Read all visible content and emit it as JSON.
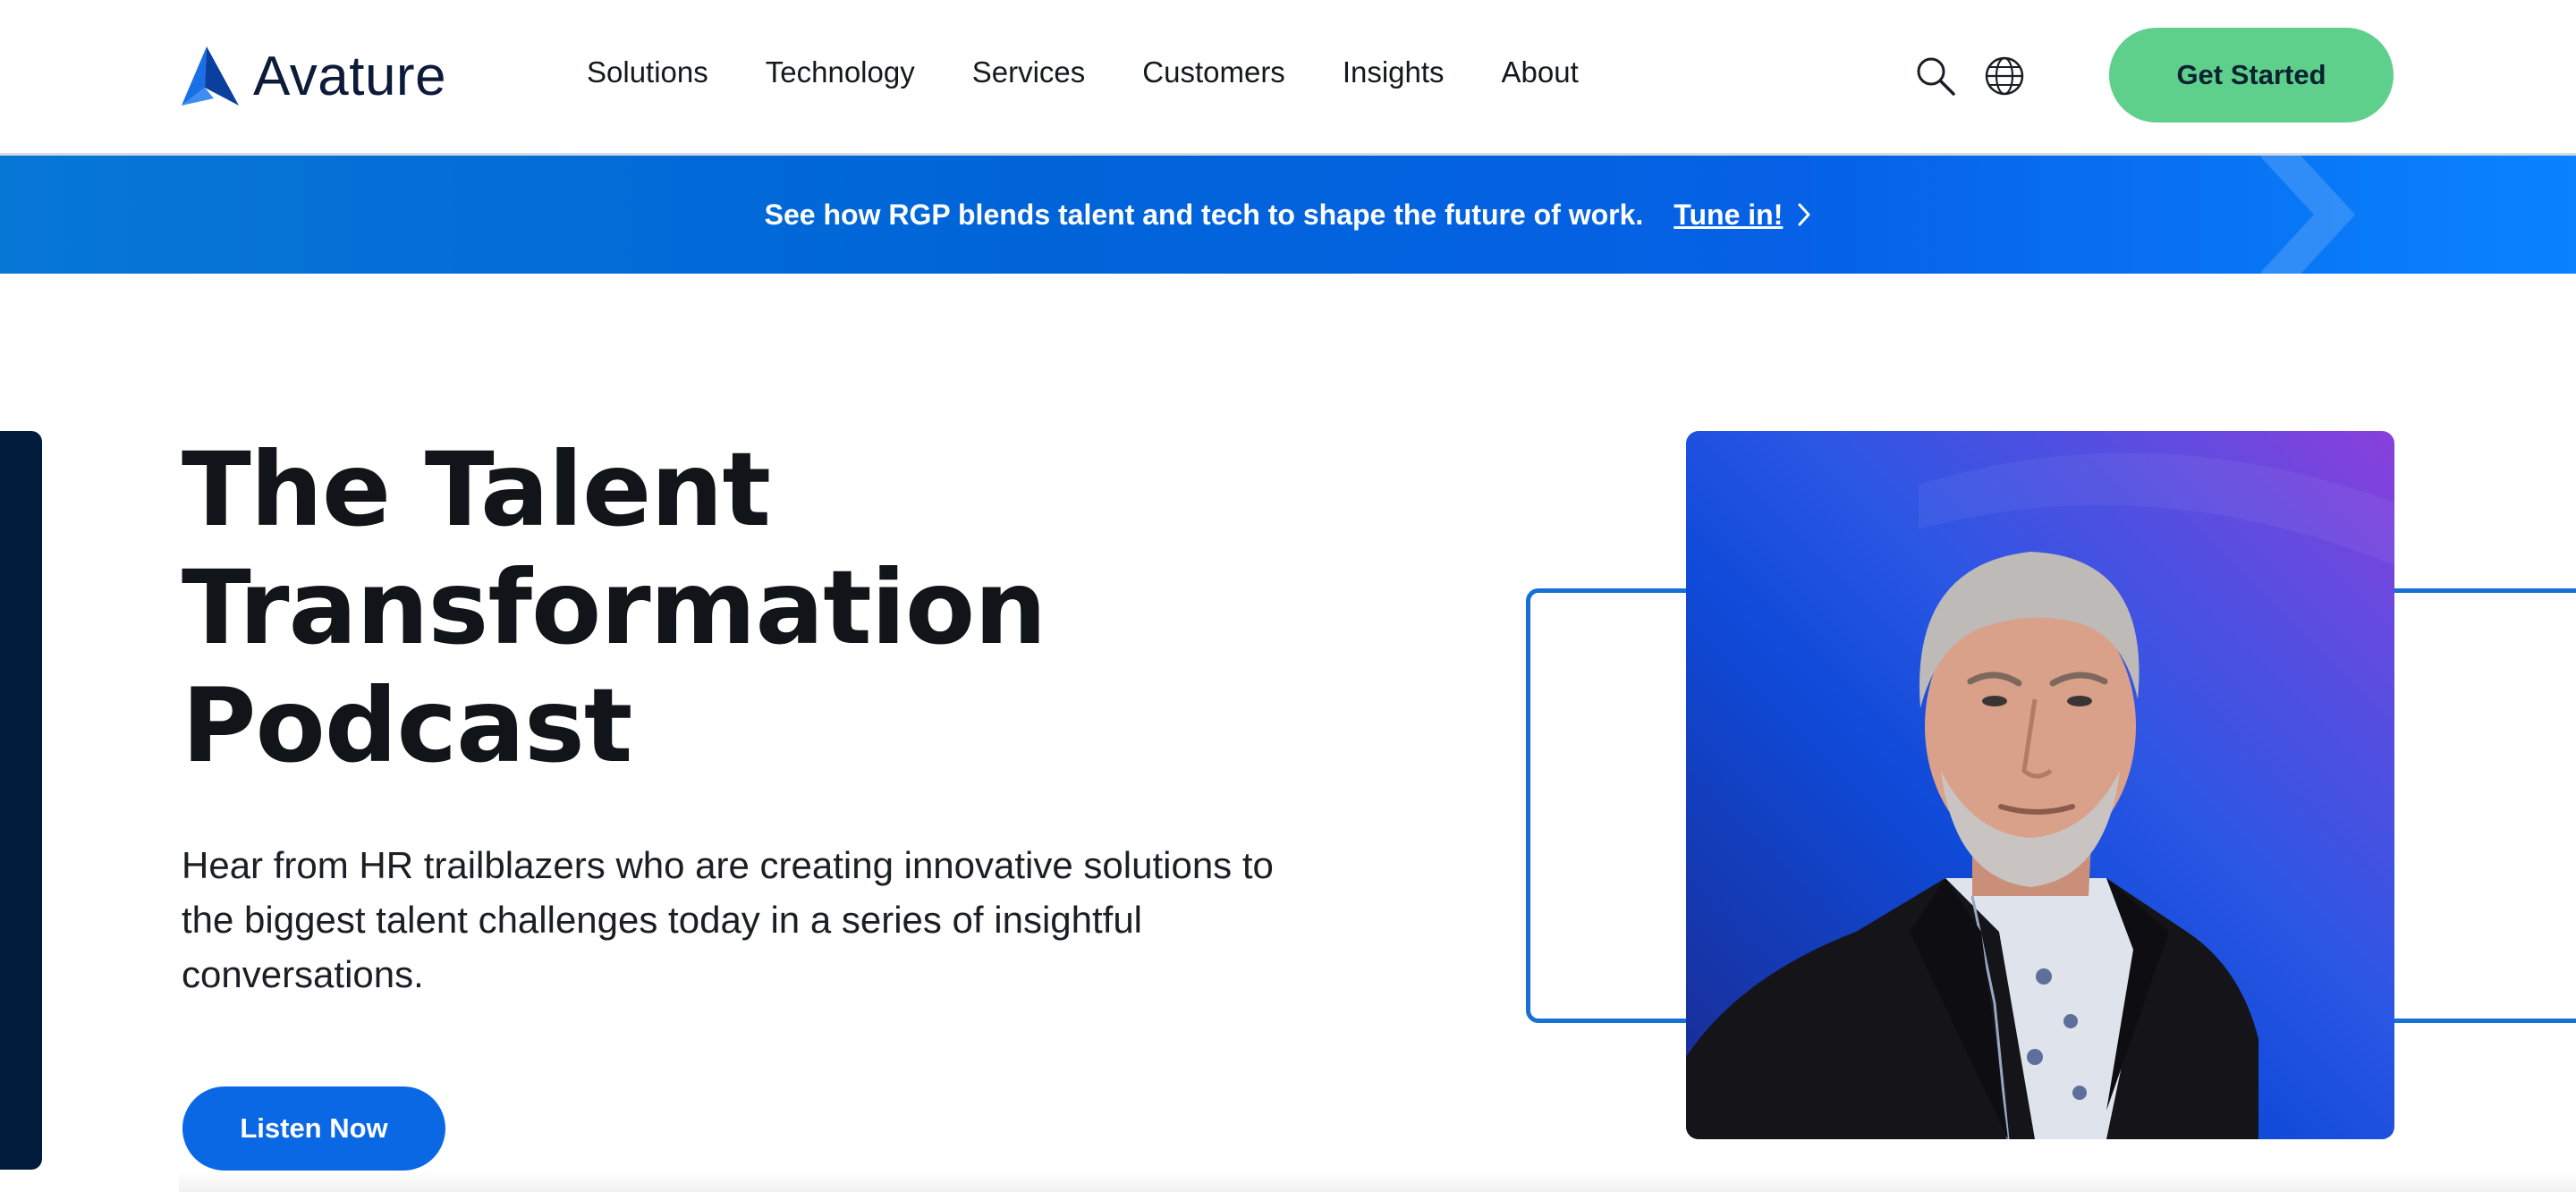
{
  "brand": {
    "name": "Avature",
    "logo_icon": "avature-logo-icon",
    "accent": "#0b68e5",
    "cta_green": "#5ed08c",
    "navy": "#001c3d"
  },
  "nav": {
    "items": [
      {
        "label": "Solutions"
      },
      {
        "label": "Technology"
      },
      {
        "label": "Services"
      },
      {
        "label": "Customers"
      },
      {
        "label": "Insights"
      },
      {
        "label": "About"
      }
    ],
    "icons": [
      "search-icon",
      "globe-icon"
    ],
    "cta_label": "Get Started"
  },
  "banner": {
    "text": "See how RGP blends talent and tech to shape the future of work.",
    "link_label": "Tune in!",
    "link_icon": "chevron-right-icon"
  },
  "hero": {
    "title_lines": [
      "The Talent",
      "Transformation",
      "Podcast"
    ],
    "description": "Hear from HR trailblazers who are creating innovative solutions to the biggest talent challenges today in a series of insightful conversations.",
    "button_label": "Listen Now",
    "image": "podcast-guest-portrait"
  }
}
